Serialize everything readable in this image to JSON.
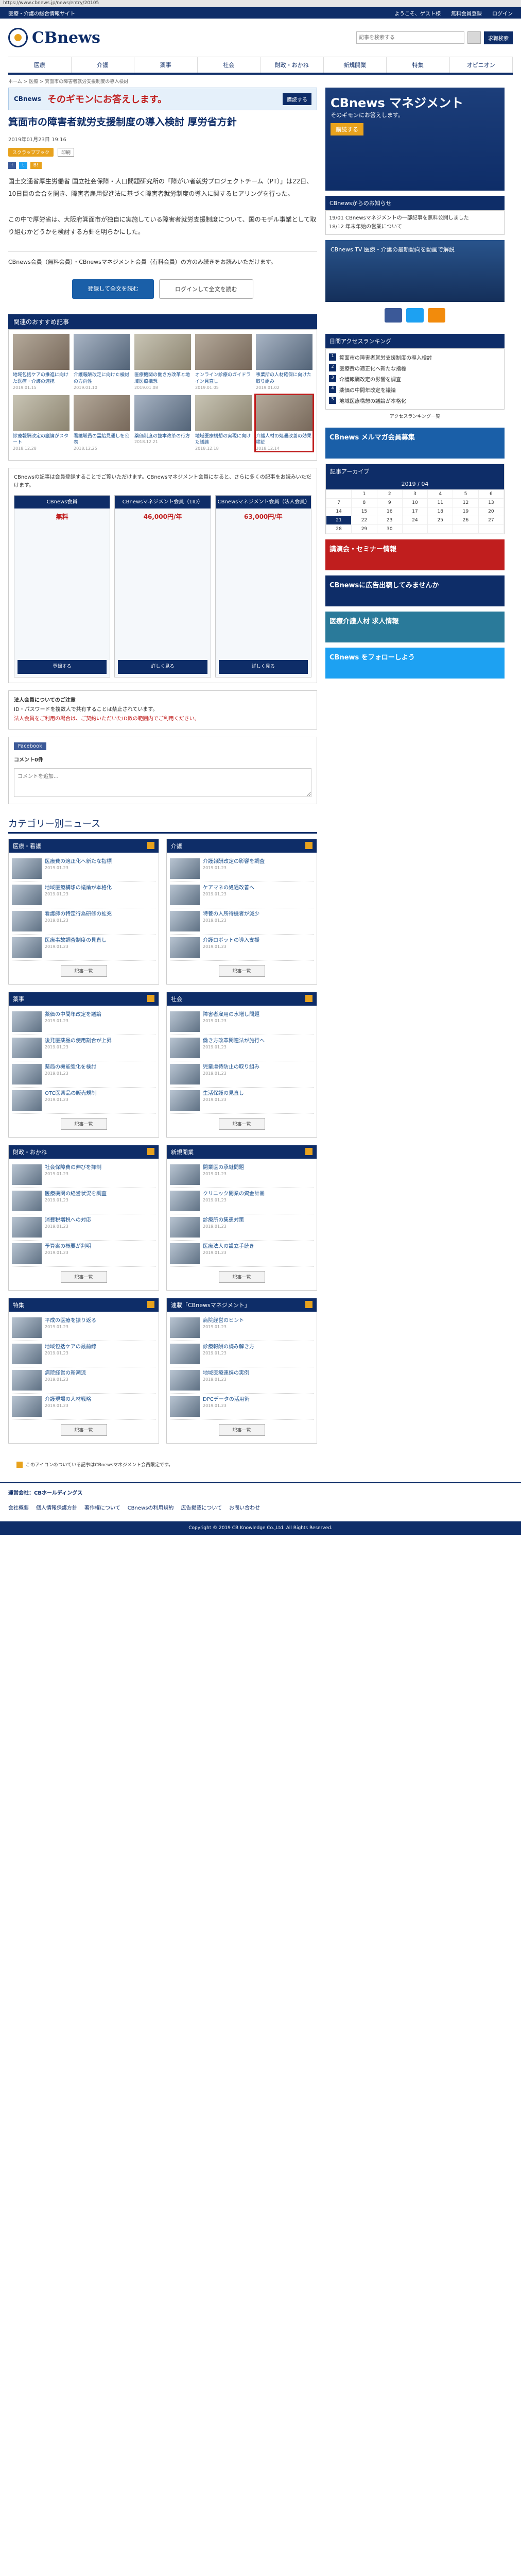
{
  "browser": {
    "url": "https://www.cbnews.jp/news/entry/20105"
  },
  "topbar": {
    "tagline": "医療・介護の総合情報サイト",
    "welcome": "ようこそ、ゲスト様",
    "free_reg": "無料会員登録",
    "login": "ログイン"
  },
  "header": {
    "logo_text": "CBnews",
    "search_placeholder": "記事を検索する",
    "jobs_label": "求職検索"
  },
  "nav": [
    "医療",
    "介護",
    "薬事",
    "社会",
    "財政・おかね",
    "新規開業",
    "特集",
    "オピニオン"
  ],
  "breadcrumb": "ホーム > 医療 > 箕面市の障害者就労支援制度の導入検討",
  "banner": {
    "brand": "CBnews",
    "text": "そのギモンにお答えします。",
    "button": "購読する"
  },
  "article": {
    "title": "箕面市の障害者就労支援制度の導入検討 厚労省方針",
    "date": "2019年01月23日 19:16",
    "category": "スクラップブック",
    "print": "印刷",
    "paragraph1": "国土交通省厚生労働省 国立社会保障・人口問題研究所の「障がい者就労プロジェクトチーム（PT）」は22日、10日目の会合を開き、障害者雇用促進法に基づく障害者就労制度の導入に関するヒアリングを行った。",
    "paragraph2": "この中で厚労省は、大阪府箕面市が独自に実施している障害者就労支援制度について、国のモデル事業として取り組むかどうかを検討する方針を明らかにした。",
    "members_note": "CBnews会員（無料会員）・CBnewsマネジメント会員（有料会員）の方のみ続きをお読みいただけます。",
    "cta_register": "登録して全文を読む",
    "cta_login": "ログインして全文を読む"
  },
  "recommend": {
    "title": "関連のおすすめ記事",
    "items": [
      {
        "t": "地域包括ケアの推進に向けた医療・介護の連携",
        "d": "2019.01.15"
      },
      {
        "t": "介護報酬改定に向けた検討の方向性",
        "d": "2019.01.10"
      },
      {
        "t": "医療機関の働き方改革と地域医療構想",
        "d": "2019.01.08"
      },
      {
        "t": "オンライン診療のガイドライン見直し",
        "d": "2019.01.05"
      },
      {
        "t": "事業所の人材確保に向けた取り組み",
        "d": "2019.01.02"
      },
      {
        "t": "診療報酬改定の議論がスタート",
        "d": "2018.12.28"
      },
      {
        "t": "看護職員の需給見通しを公表",
        "d": "2018.12.25"
      },
      {
        "t": "薬価制度の抜本改革の行方",
        "d": "2018.12.21"
      },
      {
        "t": "地域医療構想の実現に向けた議論",
        "d": "2018.12.18"
      },
      {
        "t": "介護人材の処遇改善の効果検証",
        "d": "2018.12.14"
      }
    ]
  },
  "plans": {
    "intro": "CBnewsの記事は会員登録することでご覧いただけます。CBnewsマネジメント会員になると、さらに多くの記事をお読みいただけます。",
    "columns": [
      {
        "name": "CBnews会員",
        "price": "無料",
        "button": "登録する"
      },
      {
        "name": "CBnewsマネジメント会員（1ID）",
        "price": "46,000円/年",
        "button": "詳しく見る"
      },
      {
        "name": "CBnewsマネジメント会員（法人会員）",
        "price": "63,000円/年",
        "button": "詳しく見る"
      }
    ]
  },
  "notice": {
    "title": "法人会員についてのご注意",
    "text": "ID・パスワードを複数人で共有することは禁止されています。",
    "red": "法人会員をご利用の場合は、ご契約いただいたID数の範囲内でご利用ください。"
  },
  "facebook": {
    "label": "Facebook",
    "comments": "コメント0件",
    "placeholder": "コメントを追加..."
  },
  "categories": {
    "title": "カテゴリー別ニュース",
    "boxes": [
      {
        "name": "医療・看護",
        "items": [
          "医療費の適正化へ新たな指標",
          "地域医療構想の議論が本格化",
          "看護師の特定行為研修の拡充",
          "医療事故調査制度の見直し"
        ],
        "date": "2019.01.23",
        "more": "記事一覧"
      },
      {
        "name": "介護",
        "items": [
          "介護報酬改定の影響を調査",
          "ケアマネの処遇改善へ",
          "特養の入所待機者が減少",
          "介護ロボットの導入支援"
        ],
        "date": "2019.01.23",
        "more": "記事一覧"
      },
      {
        "name": "薬事",
        "items": [
          "薬価の中間年改定を議論",
          "後発医薬品の使用割合が上昇",
          "薬局の機能強化を検討",
          "OTC医薬品の販売規制"
        ],
        "date": "2019.01.23",
        "more": "記事一覧"
      },
      {
        "name": "社会",
        "items": [
          "障害者雇用の水増し問題",
          "働き方改革関連法が施行へ",
          "児童虐待防止の取り組み",
          "生活保護の見直し"
        ],
        "date": "2019.01.23",
        "more": "記事一覧"
      },
      {
        "name": "財政・おかね",
        "items": [
          "社会保障費の伸びを抑制",
          "医療機関の経営状況を調査",
          "消費税増税への対応",
          "予算案の概要が判明"
        ],
        "date": "2019.01.23",
        "more": "記事一覧"
      },
      {
        "name": "新規開業",
        "items": [
          "開業医の承継問題",
          "クリニック開業の資金計画",
          "診療所の集患対策",
          "医療法人の設立手続き"
        ],
        "date": "2019.01.23",
        "more": "記事一覧"
      },
      {
        "name": "特集",
        "items": [
          "平成の医療を振り返る",
          "地域包括ケアの最前線",
          "病院経営の新潮流",
          "介護現場の人材戦略"
        ],
        "date": "2019.01.23",
        "more": "記事一覧"
      },
      {
        "name": "連載「CBnewsマネジメント」",
        "items": [
          "病院経営のヒント",
          "診療報酬の読み解き方",
          "地域医療連携の実例",
          "DPCデータの活用術"
        ],
        "date": "2019.01.23",
        "more": "記事一覧"
      }
    ]
  },
  "footnote": "このアイコンのついている記事はCBnewsマネジメント会員限定です。",
  "side": {
    "ad_title": "CBnews マネジメント",
    "ad_sub": "そのギモンにお答えします。",
    "ad_buy": "購読する",
    "notice_title": "CBnewsからのお知らせ",
    "notice_items": [
      "19/01 CBnewsマネジメントの一部記事を無料公開しました",
      "18/12 年末年始の営業について"
    ],
    "tv_text": "CBnews TV 医療・介護の最新動向を動画で解説",
    "ranking_title": "日間アクセスランキング",
    "ranking": [
      "箕面市の障害者就労支援制度の導入検討",
      "医療費の適正化へ新たな指標",
      "介護報酬改定の影響を調査",
      "薬価の中間年改定を議論",
      "地域医療構想の議論が本格化"
    ],
    "ranking_more": "アクセスランキング一覧",
    "ad2": "CBnews メルマガ会員募集",
    "archive_title": "記事アーカイブ",
    "month": "2019 / 04",
    "ad3": "講演会・セミナー情報",
    "ad4": "CBnewsに広告出稿してみませんか",
    "ad5": "医療介護人材 求人情報",
    "twitter": "CBnews をフォローしよう"
  },
  "footer": {
    "company": "運営会社：CBホールディングス",
    "links": [
      "会社概要",
      "個人情報保護方針",
      "著作権について",
      "CBnewsの利用規約",
      "広告掲載について",
      "お問い合わせ"
    ],
    "copyright": "Copyright © 2019 CB Knowledge Co.,Ltd. All Rights Reserved."
  }
}
